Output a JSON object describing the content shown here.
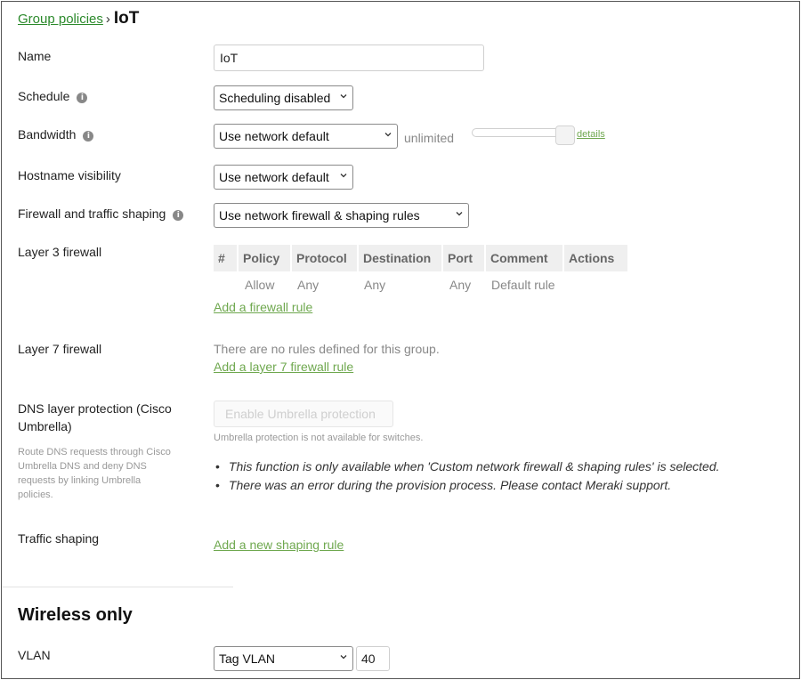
{
  "breadcrumb": {
    "parent": "Group policies",
    "separator": "›",
    "current": "IoT"
  },
  "icons": {
    "info": "info-icon",
    "dropdown": "chevron-down-icon"
  },
  "colors": {
    "link": "#6fa84f",
    "breadcrumb_link": "#2c8a2c",
    "table_header_bg": "#efefef"
  },
  "name": {
    "label": "Name",
    "value": "IoT"
  },
  "schedule": {
    "label": "Schedule",
    "selected": "Scheduling disabled"
  },
  "bandwidth": {
    "label": "Bandwidth",
    "selected": "Use network default",
    "limit_text": "unlimited",
    "details_link": "details",
    "slider_fraction": 1.0
  },
  "hostname": {
    "label": "Hostname visibility",
    "selected": "Use network default"
  },
  "firewall_shaping": {
    "label": "Firewall and traffic shaping",
    "selected": "Use network firewall & shaping rules"
  },
  "layer3": {
    "label": "Layer 3 firewall",
    "columns": [
      "#",
      "Policy",
      "Protocol",
      "Destination",
      "Port",
      "Comment",
      "Actions"
    ],
    "rows": [
      {
        "num": "",
        "policy": "Allow",
        "protocol": "Any",
        "destination": "Any",
        "port": "Any",
        "comment": "Default rule",
        "actions": ""
      }
    ],
    "add_link": "Add a firewall rule"
  },
  "layer7": {
    "label": "Layer 7 firewall",
    "empty_text": "There are no rules defined for this group.",
    "add_link": "Add a layer 7 firewall rule"
  },
  "dns": {
    "label_line1": "DNS layer protection (Cisco",
    "label_line2": "Umbrella)",
    "help_lines": [
      "Route DNS requests through Cisco",
      "Umbrella DNS and deny DNS",
      "requests by linking Umbrella",
      "policies."
    ],
    "button": "Enable Umbrella protection",
    "note": "Umbrella protection is not available for switches.",
    "bullets": [
      "This function is only available when 'Custom network firewall & shaping rules' is selected.",
      "There was an error during the provision process. Please contact Meraki support."
    ]
  },
  "traffic_shaping": {
    "label": "Traffic shaping",
    "add_link": "Add a new shaping rule"
  },
  "wireless": {
    "title": "Wireless only"
  },
  "vlan": {
    "label": "VLAN",
    "selected": "Tag VLAN",
    "value": "40"
  }
}
